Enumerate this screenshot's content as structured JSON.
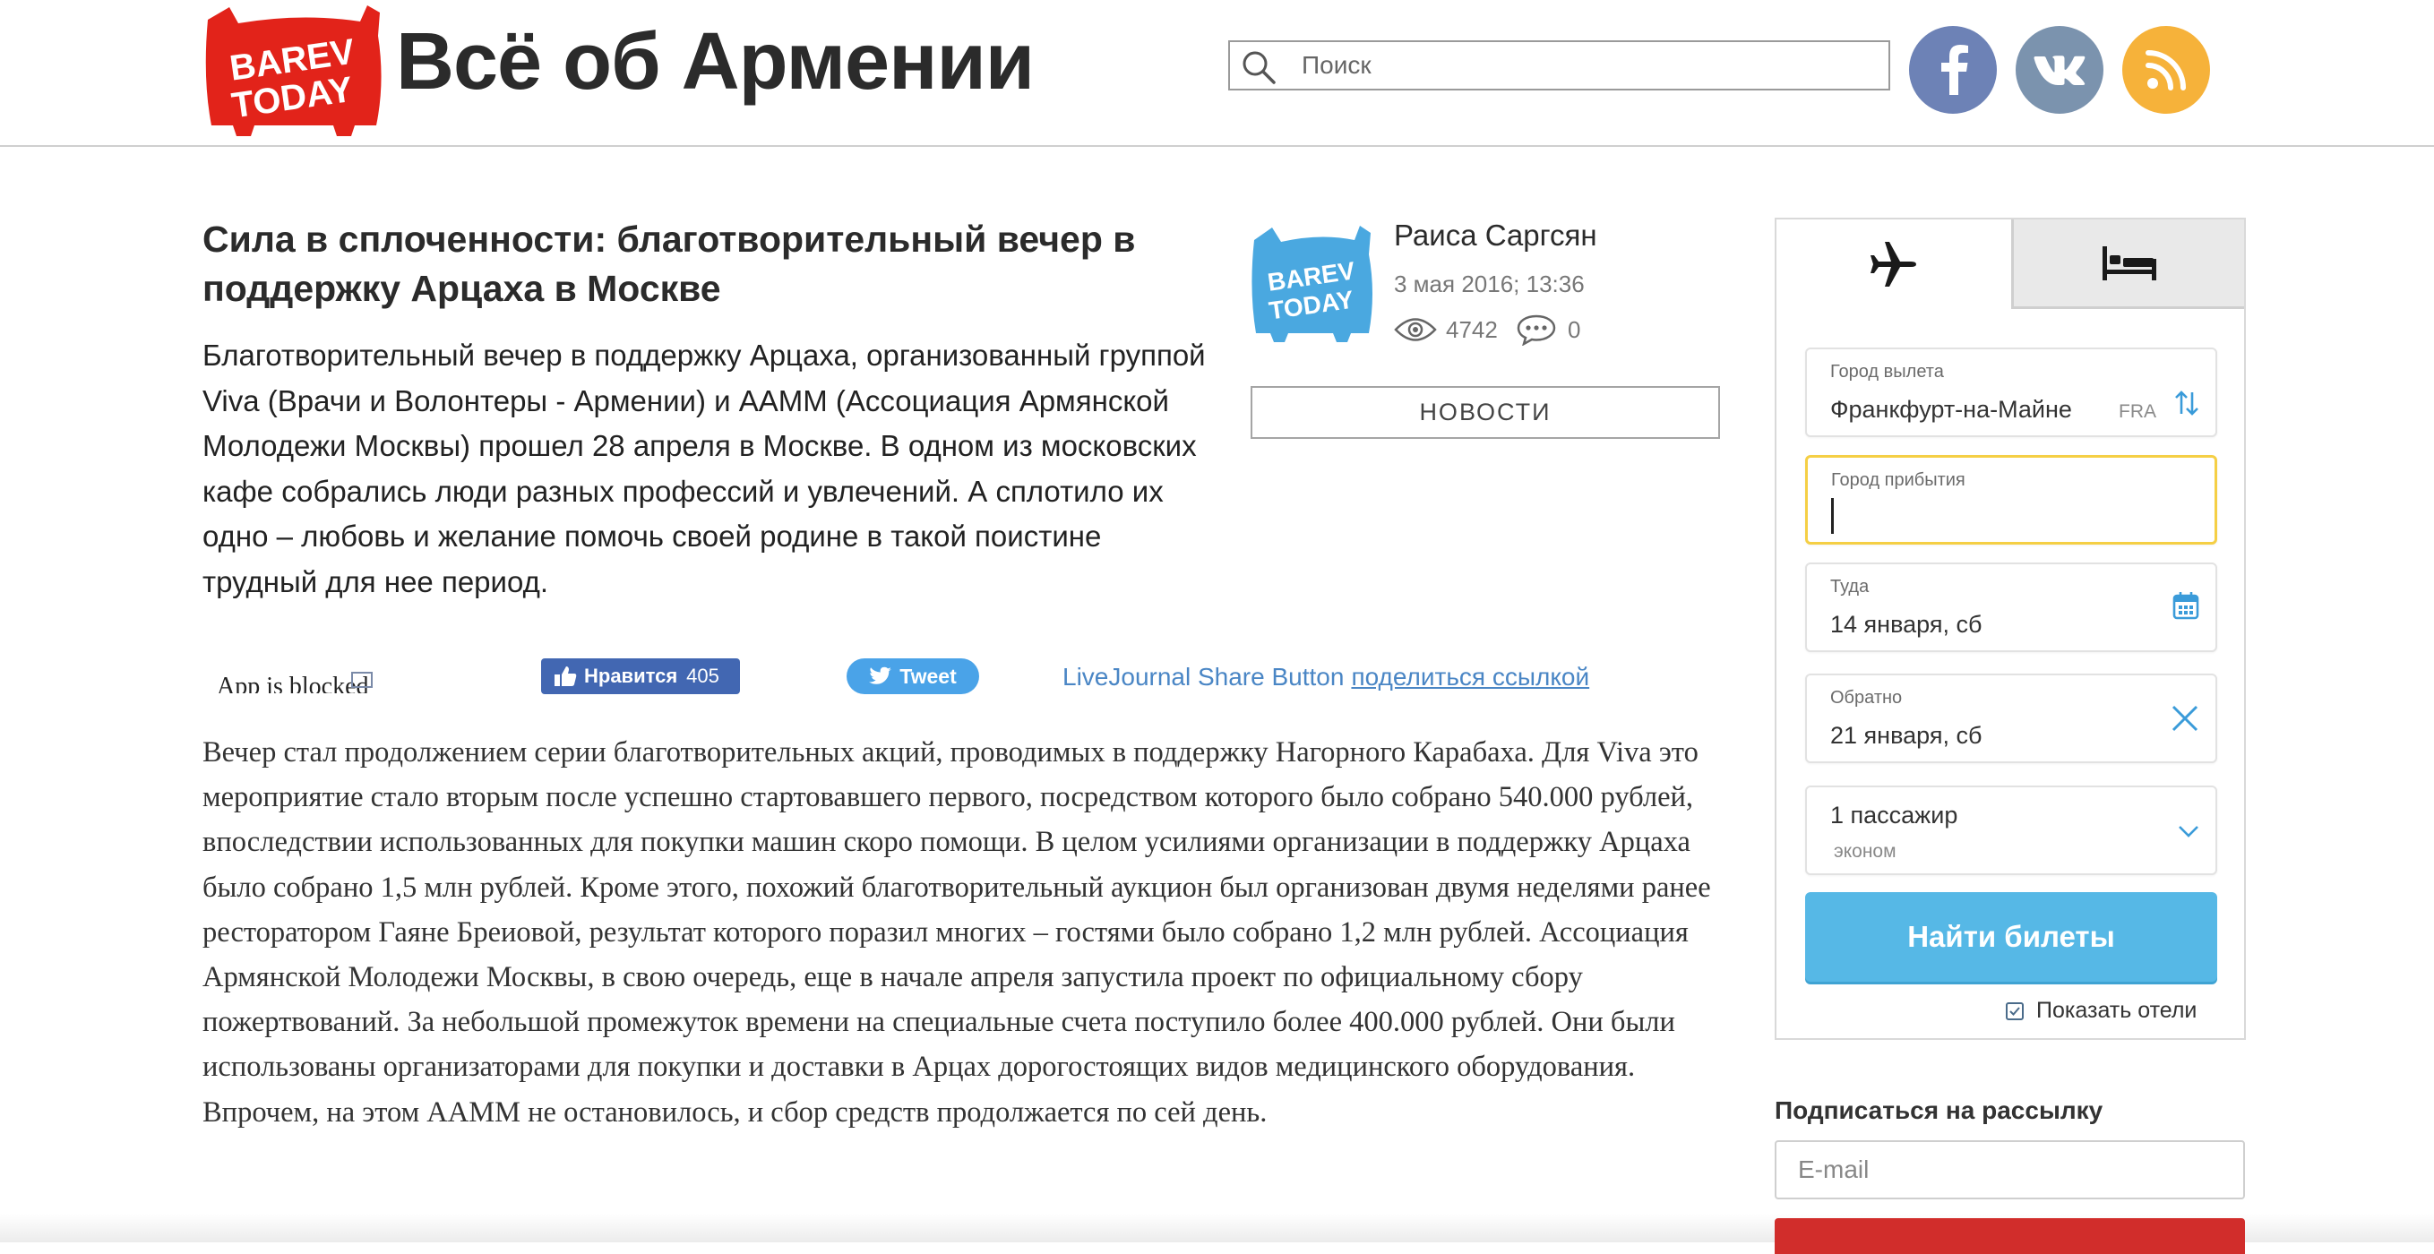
{
  "header": {
    "logo_text_top": "BAREV",
    "logo_text_bottom": "TODAY",
    "site_title": "Всё об Армении",
    "search": {
      "placeholder": "Поиск",
      "value": ""
    },
    "social": [
      {
        "name": "facebook",
        "glyph": "f",
        "color": "#6d82b6"
      },
      {
        "name": "vk",
        "glyph": "vk",
        "color": "#7b93ae"
      },
      {
        "name": "rss",
        "glyph": "rss",
        "color": "#f6b23a"
      }
    ]
  },
  "article": {
    "title": "Сила в сплоченности: благотворительный вечер в поддержку Арцаха в Москве",
    "lead": "Благотворительный вечер в поддержку Арцаха, организованный группой Viva (Врачи и Волонтеры - Армении) и ААММ (Ассоциация Армянской Молодежи Москвы) прошел 28 апреля в Москве. В одном из московских кафе собрались люди разных профессий и увлечений. А сплотило их одно – любовь и желание помочь своей родине в такой поистине трудный для нее период.",
    "author": "Раиса Саргсян",
    "date": "3 мая 2016; 13:36",
    "views": "4742",
    "comments": "0",
    "category": "НОВОСТИ",
    "share": {
      "app_blocked": "App is blocked",
      "fb_like_label": "Нравится",
      "fb_like_count": "405",
      "tweet_label": "Tweet",
      "lj_alt": "LiveJournal Share Button",
      "lj_link": "поделиться ссылкой"
    },
    "body": "Вечер стал продолжением серии благотворительных акций, проводимых в поддержку Нагорного Карабаха. Для Viva это мероприятие стало вторым после успешно стартовавшего первого, посредством которого было собрано 540.000 рублей, впоследствии использованных для покупки машин скоро помощи. В целом усилиями организации в поддержку Арцаха было собрано 1,5 млн рублей. Кроме этого, похожий благотворительный аукцион был организован двумя неделями ранее ресторатором Гаяне Бреиовой, результат которого поразил многих – гостями было собрано 1,2 млн рублей. Ассоциация Армянской Молодежи Москвы, в свою очередь, еще в начале апреля запустила проект по официальному сбору пожертвований. За небольшой промежуток времени на специальные счета поступило более 400.000 рублей. Они были использованы организаторами для покупки и доставки в Арцах дорогостоящих видов медицинского оборудования. Впрочем, на этом ААММ не остановилось, и сбор средств продолжается по сей день."
  },
  "widget": {
    "tabs": [
      {
        "name": "flights",
        "icon": "plane-icon",
        "active": true
      },
      {
        "name": "hotels",
        "icon": "bed-icon",
        "active": false
      }
    ],
    "origin": {
      "label": "Город вылета",
      "value": "Франкфурт-на-Майне",
      "iata": "FRA"
    },
    "destination": {
      "label": "Город прибытия",
      "value": ""
    },
    "depart": {
      "label": "Туда",
      "value": "14 января, сб"
    },
    "return": {
      "label": "Обратно",
      "value": "21 января, сб"
    },
    "passengers": {
      "value": "1 пассажир",
      "class": "эконом"
    },
    "search_button": "Найти билеты",
    "show_hotels": {
      "label": "Показать отели",
      "checked": true
    },
    "accent": "#56b8e6",
    "focus_color": "#f5cf45"
  },
  "newsletter": {
    "title": "Подписаться на рассылку",
    "email_placeholder": "E-mail",
    "button_color": "#d12d2b"
  }
}
